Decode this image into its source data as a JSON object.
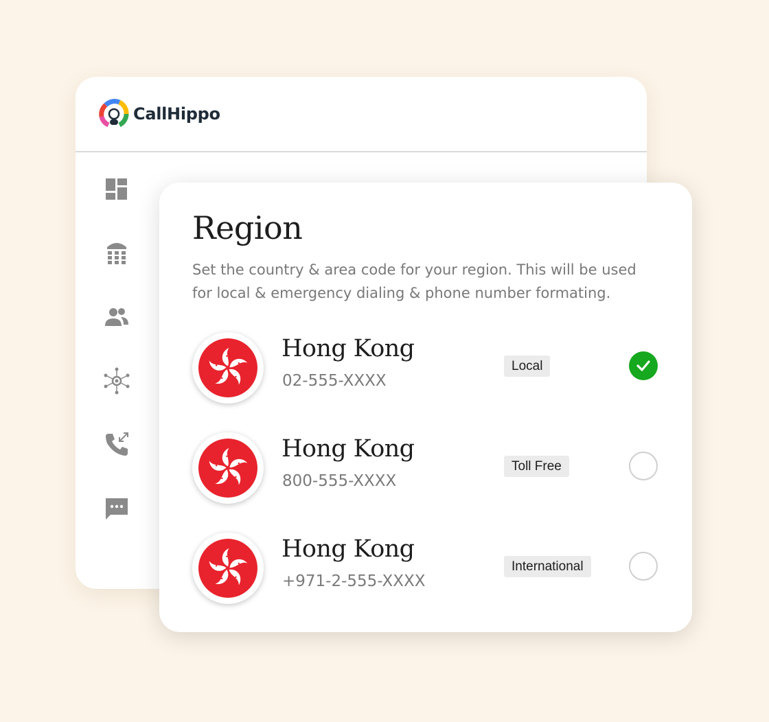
{
  "app": {
    "brand_name": "CallHippo",
    "sidebar": [
      {
        "icon": "dashboard-icon"
      },
      {
        "icon": "dialpad-icon"
      },
      {
        "icon": "contacts-icon"
      },
      {
        "icon": "integrations-icon"
      },
      {
        "icon": "call-logs-icon"
      },
      {
        "icon": "messages-icon"
      }
    ]
  },
  "region": {
    "title": "Region",
    "description": "Set the country & area code for your region. This will be used for local & emergency dialing & phone number formating.",
    "options": [
      {
        "country": "Hong Kong",
        "number": "02-555-XXXX",
        "type": "Local",
        "selected": true,
        "flag_icon": "hong-kong-flag-icon"
      },
      {
        "country": "Hong Kong",
        "number": "800-555-XXXX",
        "type": "Toll Free",
        "selected": false,
        "flag_icon": "hong-kong-flag-icon"
      },
      {
        "country": "Hong Kong",
        "number": "+971-2-555-XXXX",
        "type": "International",
        "selected": false,
        "flag_icon": "hong-kong-flag-icon"
      }
    ]
  },
  "colors": {
    "background": "#fcf4e8",
    "selected": "#16a81e",
    "flag_red": "#e8232d",
    "icon_gray": "#8a8a8a"
  }
}
